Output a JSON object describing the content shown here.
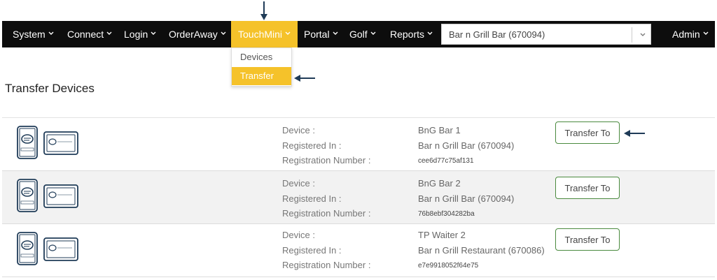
{
  "colors": {
    "accent": "#f5c22a",
    "navbar_bg": "#0d0d0d",
    "arrow": "#1f3b57",
    "button_border": "#4a8a3e"
  },
  "nav": {
    "items": [
      {
        "label": "System"
      },
      {
        "label": "Connect"
      },
      {
        "label": "Login"
      },
      {
        "label": "OrderAway"
      },
      {
        "label": "TouchMini"
      },
      {
        "label": "Portal"
      },
      {
        "label": "Golf"
      },
      {
        "label": "Reports"
      }
    ],
    "location_select": {
      "value": "Bar n Grill Bar (670094)"
    },
    "admin_label": "Admin"
  },
  "dropdown": {
    "items": [
      {
        "label": "Devices"
      },
      {
        "label": "Transfer"
      }
    ]
  },
  "page": {
    "title": "Transfer Devices"
  },
  "labels": {
    "device": "Device :",
    "registered_in": "Registered In :",
    "registration_number": "Registration Number :"
  },
  "devices": [
    {
      "name": "BnG Bar 1",
      "registered_in": "Bar n Grill Bar (670094)",
      "registration_number": "cee6d77c75af131",
      "button": "Transfer To"
    },
    {
      "name": "BnG Bar 2",
      "registered_in": "Bar n Grill Bar (670094)",
      "registration_number": "76b8ebf304282ba",
      "button": "Transfer To"
    },
    {
      "name": "TP Waiter 2",
      "registered_in": "Bar n Grill Restaurant (670086)",
      "registration_number": "e7e9918052f64e75",
      "button": "Transfer To"
    }
  ],
  "icons": {
    "device_phone": "orderaway-phone-icon",
    "device_tablet": "orderaway-tablet-icon",
    "logo_text": "OrderAway"
  }
}
